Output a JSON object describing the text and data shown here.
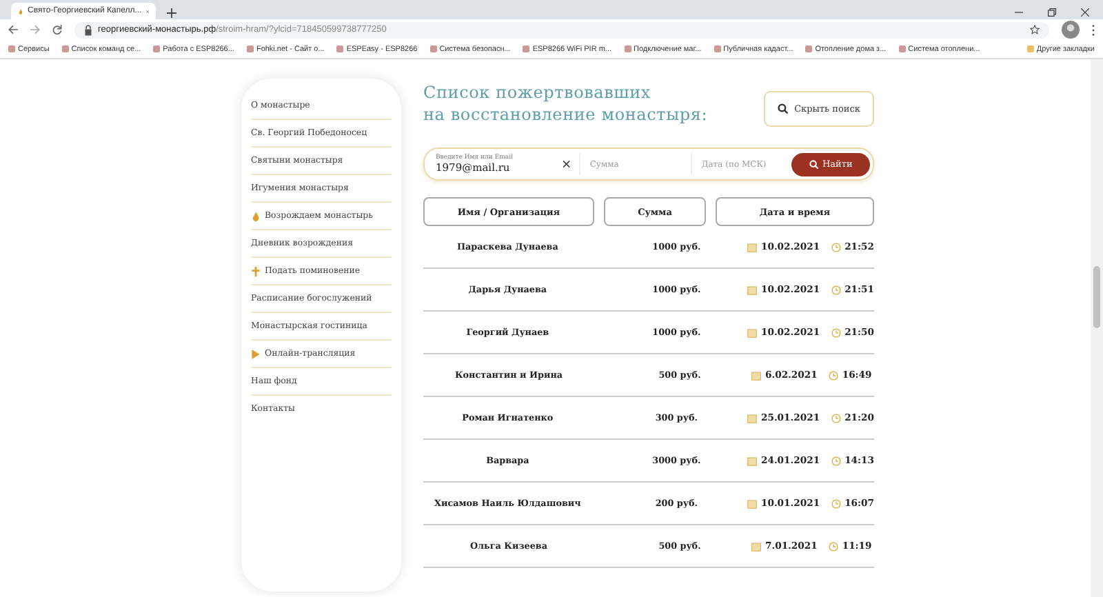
{
  "browser": {
    "tab_title": "Свято-Георгиевский Капелл...",
    "url_host": "георгиевский-монастырь.рф",
    "url_path": "/stroim-hram/?ylcid=718450599738777250",
    "bookmarks": [
      {
        "label": "Сервисы"
      },
      {
        "label": "Список команд се..."
      },
      {
        "label": "Работа с ESP8266..."
      },
      {
        "label": "Fohki.net - Сайт о..."
      },
      {
        "label": "ESPEasy - ESP8266"
      },
      {
        "label": "Система безопасн..."
      },
      {
        "label": "ESP8266 WiFi PIR m..."
      },
      {
        "label": "Подключение маг..."
      },
      {
        "label": "Публичная кадаст..."
      },
      {
        "label": "Отопление дома з..."
      },
      {
        "label": "Система отоплени..."
      }
    ],
    "other_bookmarks": "Другие закладки"
  },
  "sidebar": {
    "items": [
      {
        "label": "О монастыре",
        "kind": "plain"
      },
      {
        "label": "Св. Георгий Победоносец",
        "kind": "plain"
      },
      {
        "label": "Святыни монастыря",
        "kind": "plain"
      },
      {
        "label": "Игумения монастыря",
        "kind": "plain"
      },
      {
        "label": "Возрождаем монастырь",
        "kind": "flame"
      },
      {
        "label": "Дневник возрождения",
        "kind": "plain"
      },
      {
        "label": "Подать поминовение",
        "kind": "cross"
      },
      {
        "label": "Расписание богослужений",
        "kind": "plain"
      },
      {
        "label": "Монастырская гостиница",
        "kind": "plain"
      },
      {
        "label": "Онлайн-трансляция",
        "kind": "play"
      },
      {
        "label": "Наш фонд",
        "kind": "plain"
      },
      {
        "label": "Контакты",
        "kind": "plain"
      }
    ]
  },
  "title_lines": [
    "Список пожертвовавших",
    "на восстановление монастыря:"
  ],
  "hide_search_button": "Скрыть поиск",
  "search": {
    "name_label": "Введите Имя или Email",
    "name_value": "1979@mail.ru",
    "sum_placeholder": "Сумма",
    "date_placeholder": "Дата (по МСК)",
    "submit": "Найти"
  },
  "table": {
    "columns": [
      "Имя / Организация",
      "Сумма",
      "Дата и время"
    ],
    "rows": [
      {
        "name": "Параскева Дунаева",
        "amount": "1000 руб.",
        "date": "10.02.2021",
        "time": "21:52"
      },
      {
        "name": "Дарья Дунаева",
        "amount": "1000 руб.",
        "date": "10.02.2021",
        "time": "21:51"
      },
      {
        "name": "Георгий Дунаев",
        "amount": "1000 руб.",
        "date": "10.02.2021",
        "time": "21:50"
      },
      {
        "name": "Константин и Ирина",
        "amount": "500 руб.",
        "date": "6.02.2021",
        "time": "16:49"
      },
      {
        "name": "Роман Игнатенко",
        "amount": "300 руб.",
        "date": "25.01.2021",
        "time": "21:20"
      },
      {
        "name": "Варвара",
        "amount": "3000 руб.",
        "date": "24.01.2021",
        "time": "14:13"
      },
      {
        "name": "Хисамов Наиль Юлдашович",
        "amount": "200 руб.",
        "date": "10.01.2021",
        "time": "16:07"
      },
      {
        "name": "Ольга Кизеева",
        "amount": "500 руб.",
        "date": "7.01.2021",
        "time": "11:19"
      }
    ]
  }
}
